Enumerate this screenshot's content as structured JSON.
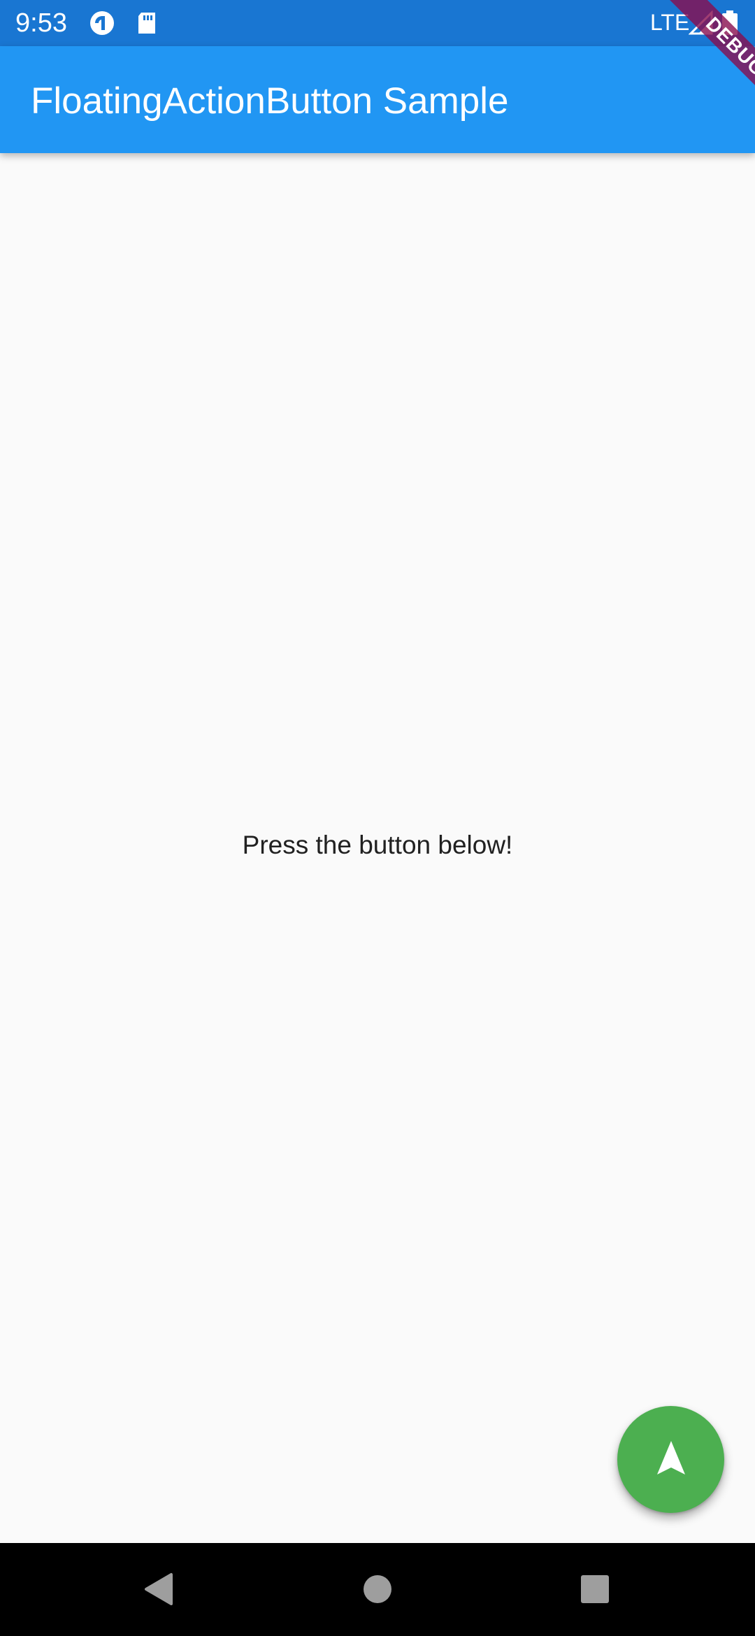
{
  "status_bar": {
    "time": "9:53",
    "network": "LTE",
    "icons": [
      "pocket-casts-icon",
      "sd-card-icon",
      "signal-icon",
      "battery-icon"
    ]
  },
  "app_bar": {
    "title": "FloatingActionButton Sample"
  },
  "debug_banner": {
    "label": "DEBUG"
  },
  "body": {
    "message": "Press the button below!"
  },
  "fab": {
    "icon": "navigation-icon",
    "color": "#4caf50"
  },
  "nav_bar": {
    "buttons": [
      "back-icon",
      "home-icon",
      "recents-icon"
    ]
  },
  "colors": {
    "status_bar": "#1976d2",
    "app_bar": "#2196f3",
    "background": "#fafafa",
    "debug_banner": "#880e4f"
  }
}
